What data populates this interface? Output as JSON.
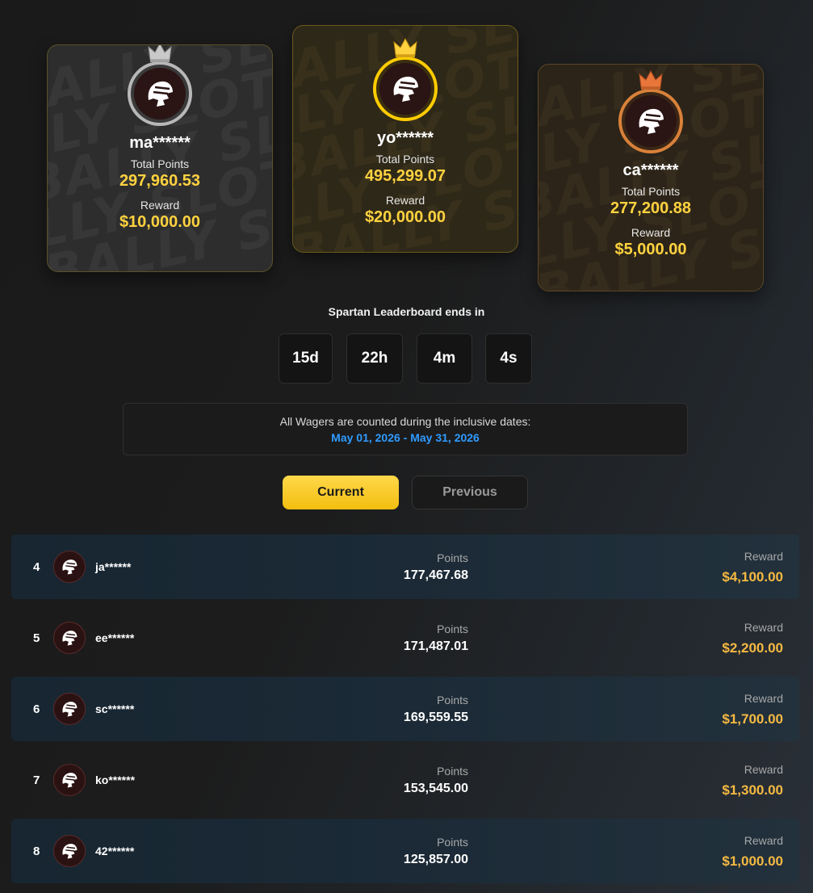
{
  "podium": [
    {
      "place": "silver",
      "name": "ma******",
      "points_label": "Total Points",
      "points": "297,960.53",
      "reward_label": "Reward",
      "reward": "$10,000.00"
    },
    {
      "place": "gold",
      "name": "yo******",
      "points_label": "Total Points",
      "points": "495,299.07",
      "reward_label": "Reward",
      "reward": "$20,000.00"
    },
    {
      "place": "bronze",
      "name": "ca******",
      "points_label": "Total Points",
      "points": "277,200.88",
      "reward_label": "Reward",
      "reward": "$5,000.00"
    }
  ],
  "watermark": "BALLYSLOTS",
  "countdown": {
    "label": "Spartan Leaderboard ends in",
    "days": "15d",
    "hours": "22h",
    "minutes": "4m",
    "seconds": "4s"
  },
  "dates": {
    "title": "All Wagers are counted during the inclusive dates:",
    "range": "May 01, 2026 - May 31, 2026"
  },
  "tabs": {
    "current": "Current",
    "previous": "Previous"
  },
  "rows": [
    {
      "rank": "4",
      "name": "ja******",
      "points_label": "Points",
      "points": "177,467.68",
      "reward_label": "Reward",
      "reward": "$4,100.00"
    },
    {
      "rank": "5",
      "name": "ee******",
      "points_label": "Points",
      "points": "171,487.01",
      "reward_label": "Reward",
      "reward": "$2,200.00"
    },
    {
      "rank": "6",
      "name": "sc******",
      "points_label": "Points",
      "points": "169,559.55",
      "reward_label": "Reward",
      "reward": "$1,700.00"
    },
    {
      "rank": "7",
      "name": "ko******",
      "points_label": "Points",
      "points": "153,545.00",
      "reward_label": "Reward",
      "reward": "$1,300.00"
    },
    {
      "rank": "8",
      "name": "42******",
      "points_label": "Points",
      "points": "125,857.00",
      "reward_label": "Reward",
      "reward": "$1,000.00"
    }
  ],
  "colors": {
    "gold": "#ffd23f",
    "reward": "#f5b942",
    "date_blue": "#2f9bff",
    "silver_ring": "#b8b8b8",
    "gold_ring": "#ffcc00",
    "bronze_ring": "#d9813a"
  },
  "icons": {
    "avatar": "spartan-helmet-icon",
    "crown": "crown-icon"
  }
}
